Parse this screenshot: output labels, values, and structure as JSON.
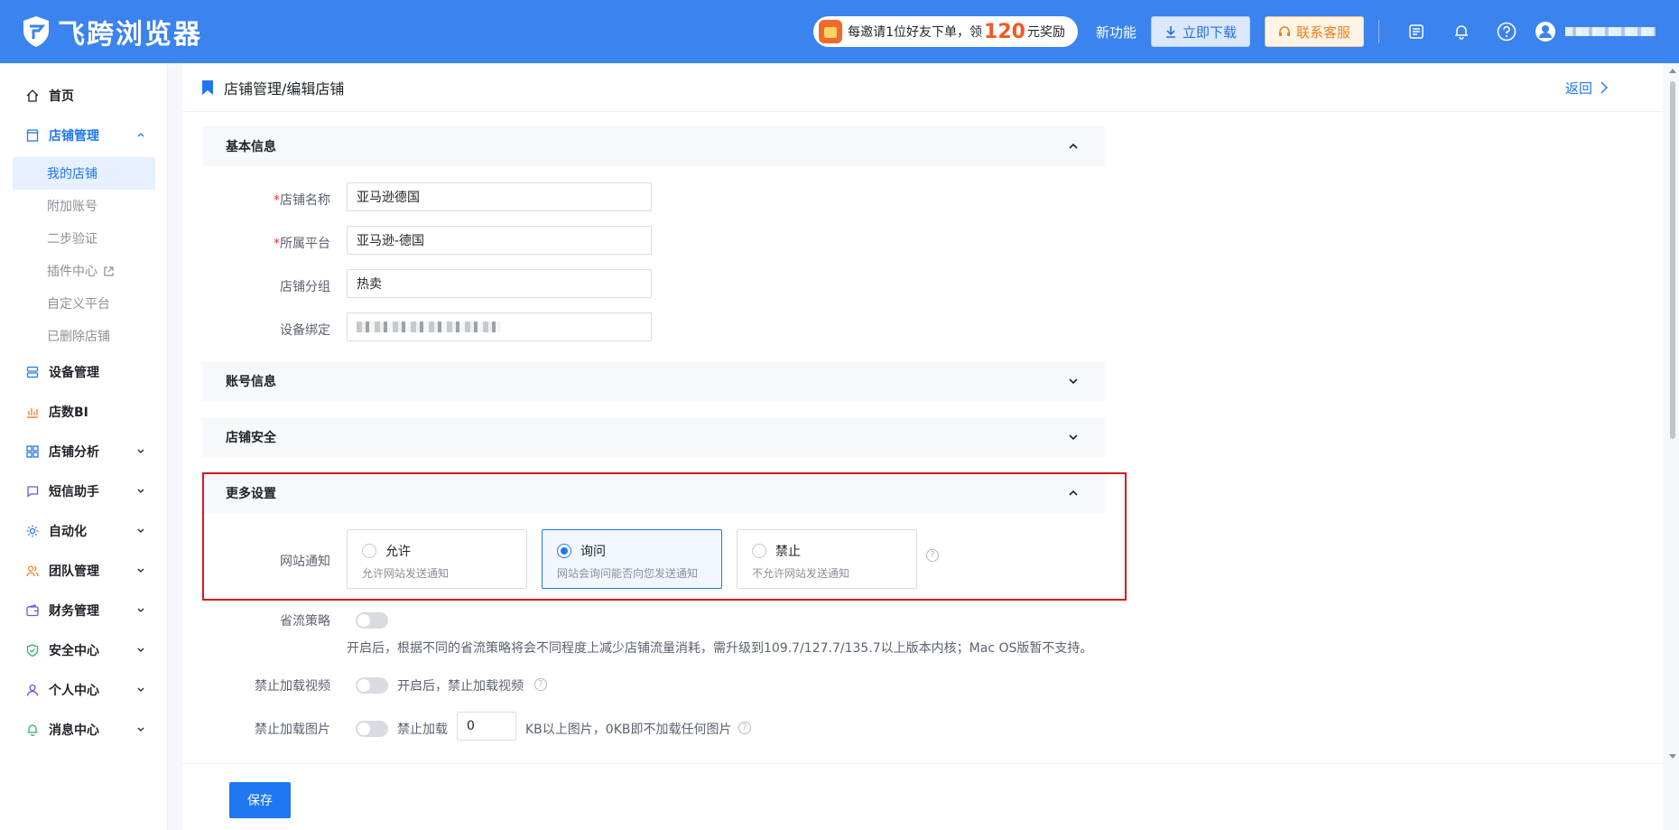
{
  "app": {
    "brand": "飞跨浏览器"
  },
  "topbar": {
    "promo_prefix": "每邀请1位好友下单，领",
    "promo_amount": "120",
    "promo_suffix": "元奖励",
    "new_feature": "新功能",
    "download": "立即下载",
    "support": "联系客服"
  },
  "sidebar": {
    "home": "首页",
    "shop_mgmt": "店铺管理",
    "sub": {
      "my_shops": "我的店铺",
      "extra_accounts": "附加账号",
      "two_step": "二步验证",
      "plugins": "插件中心",
      "custom_platform": "自定义平台",
      "deleted_shops": "已删除店铺"
    },
    "device_mgmt": "设备管理",
    "shop_bi": "店数BI",
    "shop_analysis": "店铺分析",
    "sms": "短信助手",
    "automation": "自动化",
    "team": "团队管理",
    "finance": "财务管理",
    "security": "安全中心",
    "personal": "个人中心",
    "messages": "消息中心"
  },
  "breadcrumb": {
    "path": "店铺管理/编辑店铺",
    "back": "返回"
  },
  "sections": {
    "basic": "基本信息",
    "account": "账号信息",
    "security": "店铺安全",
    "more": "更多设置"
  },
  "form": {
    "req": "*",
    "shop_name_label": "店铺名称",
    "shop_name": "亚马逊德国",
    "platform_label": "所属平台",
    "platform": "亚马逊-德国",
    "group_label": "店铺分组",
    "group": "热卖",
    "device_label": "设备绑定"
  },
  "notify": {
    "label": "网站通知",
    "options": [
      {
        "title": "允许",
        "desc": "允许网站发送通知"
      },
      {
        "title": "询问",
        "desc": "网站会询问能否向您发送通知"
      },
      {
        "title": "禁止",
        "desc": "不允许网站发送通知"
      }
    ],
    "selected_index": 1,
    "help": "?"
  },
  "traffic": {
    "label": "省流策略",
    "desc": "开启后，根据不同的省流策略将会不同程度上减少店铺流量消耗，需升级到109.7/127.7/135.7以上版本内核；Mac OS版暂不支持。"
  },
  "video": {
    "label": "禁止加载视频",
    "desc": "开启后，禁止加载视频",
    "help": "?"
  },
  "images": {
    "label": "禁止加载图片",
    "prefix": "禁止加载",
    "value": "0",
    "suffix": "KB以上图片，0KB即不加载任何图片",
    "help": "?"
  },
  "footer": {
    "save": "保存"
  },
  "colors": {
    "primary": "#1f77f2",
    "topbar": "#3b83ee",
    "highlight": "#d9191b"
  }
}
